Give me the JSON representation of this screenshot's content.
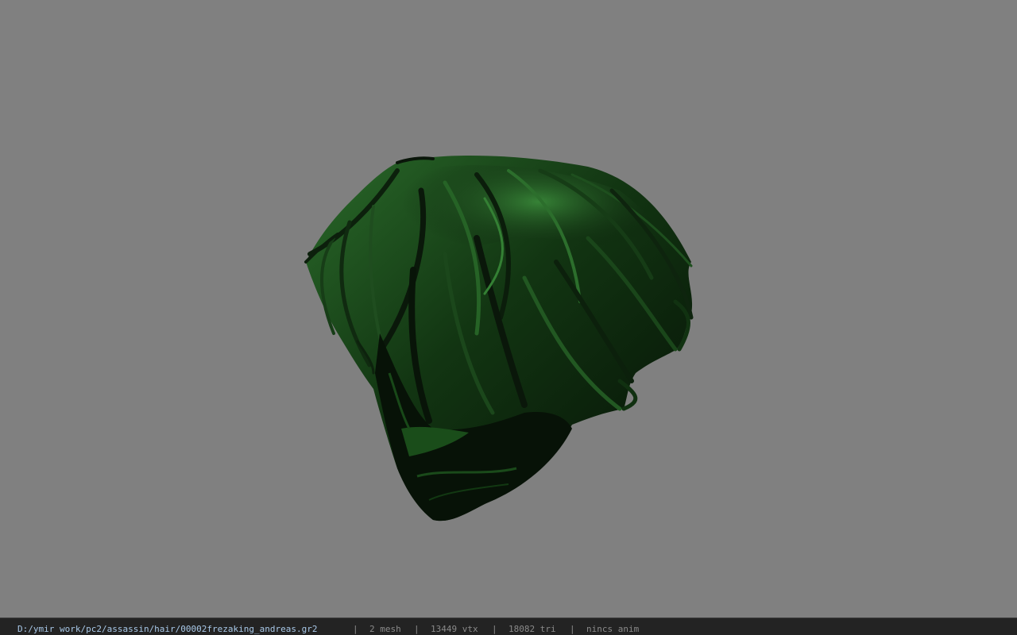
{
  "viewport": {
    "background_color": "#808080",
    "model_color_dark": "#0a1a0a",
    "model_color_mid": "#1c4a1c",
    "model_color_highlight": "#2f7a2f"
  },
  "status": {
    "file_path": "D:/ymir work/pc2/assassin/hair/00002frezaking_andreas.gr2",
    "separator": "|",
    "mesh": "2 mesh",
    "vertices": "13449 vtx",
    "triangles": "18082 tri",
    "anim": "nincs anim"
  }
}
